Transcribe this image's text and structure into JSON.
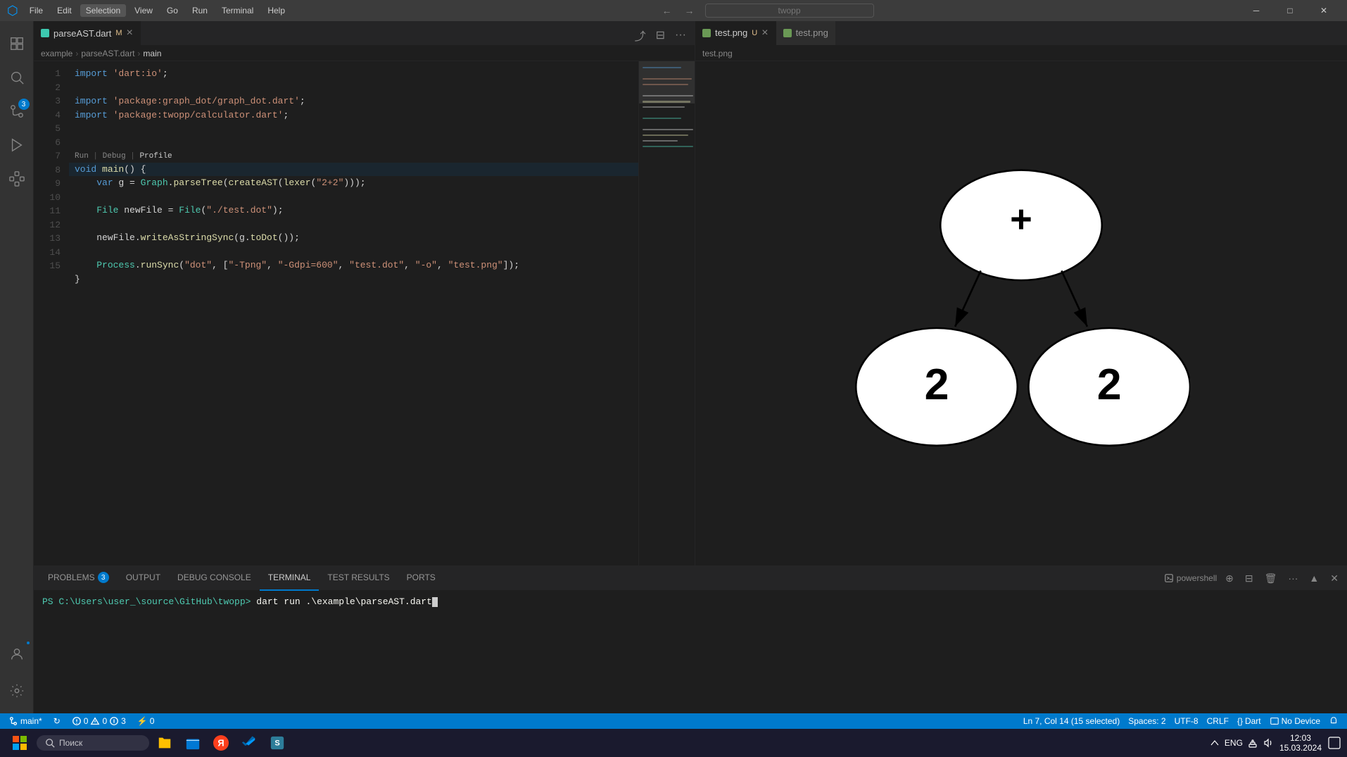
{
  "titlebar": {
    "icon": "⬡",
    "menu": [
      "File",
      "Edit",
      "Selection",
      "View",
      "Go",
      "Run",
      "Terminal",
      "Help"
    ],
    "search_placeholder": "twopp",
    "nav_back": "←",
    "nav_forward": "→",
    "controls": [
      "─",
      "□",
      "✕"
    ]
  },
  "left_editor": {
    "tab_filename": "parseAST.dart",
    "tab_status": "M",
    "breadcrumb": [
      "example",
      ">",
      "parseAST.dart",
      ">",
      "main"
    ],
    "lines": [
      {
        "num": 1,
        "tokens": [
          {
            "t": "kw",
            "v": "import"
          },
          {
            "t": "op",
            "v": " "
          },
          {
            "t": "str",
            "v": "'dart:io'"
          }
        ],
        "suffix": ";"
      },
      {
        "num": 2,
        "tokens": []
      },
      {
        "num": 3,
        "tokens": [
          {
            "t": "kw",
            "v": "import"
          },
          {
            "t": "op",
            "v": " "
          },
          {
            "t": "str",
            "v": "'package:graph_dot/graph_dot.dart'"
          }
        ],
        "suffix": ";"
      },
      {
        "num": 4,
        "tokens": [
          {
            "t": "kw",
            "v": "import"
          },
          {
            "t": "op",
            "v": " "
          },
          {
            "t": "str",
            "v": "'package:twopp/calculator.dart'"
          }
        ],
        "suffix": ";"
      },
      {
        "num": 5,
        "tokens": []
      },
      {
        "num": 6,
        "tokens": []
      },
      {
        "num": 7,
        "tokens": [
          {
            "t": "kw",
            "v": "void"
          },
          {
            "t": "op",
            "v": " "
          },
          {
            "t": "fn",
            "v": "main"
          },
          {
            "t": "op",
            "v": "() {"
          }
        ]
      },
      {
        "num": 8,
        "tokens": [
          {
            "t": "op",
            "v": "    "
          },
          {
            "t": "kw",
            "v": "var"
          },
          {
            "t": "op",
            "v": " g = "
          },
          {
            "t": "type",
            "v": "Graph"
          },
          {
            "t": "op",
            "v": "."
          },
          {
            "t": "fn",
            "v": "parseTree"
          },
          {
            "t": "op",
            "v": "("
          },
          {
            "t": "fn",
            "v": "createAST"
          },
          {
            "t": "op",
            "v": "("
          },
          {
            "t": "fn",
            "v": "lexer"
          },
          {
            "t": "op",
            "v": "("
          },
          {
            "t": "str",
            "v": "\"2+2\""
          },
          {
            "t": "op",
            "v": ")))"
          }
        ],
        "suffix": ";"
      },
      {
        "num": 9,
        "tokens": []
      },
      {
        "num": 10,
        "tokens": [
          {
            "t": "op",
            "v": "    "
          },
          {
            "t": "type",
            "v": "File"
          },
          {
            "t": "op",
            "v": " newFile = "
          },
          {
            "t": "type",
            "v": "File"
          },
          {
            "t": "op",
            "v": "("
          },
          {
            "t": "str",
            "v": "\"./test.dot\""
          },
          {
            "t": "op",
            "v": ")"
          }
        ],
        "suffix": ";"
      },
      {
        "num": 11,
        "tokens": []
      },
      {
        "num": 12,
        "tokens": [
          {
            "t": "op",
            "v": "    newFile."
          },
          {
            "t": "fn",
            "v": "writeAsStringSync"
          },
          {
            "t": "op",
            "v": "(g."
          },
          {
            "t": "fn",
            "v": "toDot"
          },
          {
            "t": "op",
            "v": "())"
          }
        ],
        "suffix": ";"
      },
      {
        "num": 13,
        "tokens": []
      },
      {
        "num": 14,
        "tokens": [
          {
            "t": "op",
            "v": "    "
          },
          {
            "t": "type",
            "v": "Process"
          },
          {
            "t": "op",
            "v": "."
          },
          {
            "t": "fn",
            "v": "runSync"
          },
          {
            "t": "op",
            "v": "("
          },
          {
            "t": "str",
            "v": "\"dot\""
          },
          {
            "t": "op",
            "v": ", ["
          },
          {
            "t": "str",
            "v": "\"-Tpng\""
          },
          {
            "t": "op",
            "v": ", "
          },
          {
            "t": "str",
            "v": "\"-Gdpi=600\""
          },
          {
            "t": "op",
            "v": ", "
          },
          {
            "t": "str",
            "v": "\"test.dot\""
          },
          {
            "t": "op",
            "v": ", "
          },
          {
            "t": "str",
            "v": "\"-o\""
          },
          {
            "t": "op",
            "v": ", "
          },
          {
            "t": "str",
            "v": "\"test.png\""
          },
          {
            "t": "op",
            "v": "])"
          }
        ],
        "suffix": ";"
      },
      {
        "num": 15,
        "tokens": [
          {
            "t": "op",
            "v": "}"
          }
        ]
      }
    ],
    "run_debug_profile": "Run | Debug | Profile"
  },
  "right_editor": {
    "tab_filename": "test.png",
    "tab_status": "U",
    "breadcrumb_item": "test.png"
  },
  "ast": {
    "root_label": "+",
    "left_label": "2",
    "right_label": "2"
  },
  "bottom_panel": {
    "tabs": [
      "PROBLEMS",
      "OUTPUT",
      "DEBUG CONSOLE",
      "TERMINAL",
      "TEST RESULTS",
      "PORTS"
    ],
    "problems_count": "3",
    "active_tab": "TERMINAL",
    "terminal_shell": "powershell",
    "terminal_prompt": "PS C:\\Users\\user_\\source\\GitHub\\twopp>",
    "terminal_command": "dart run .\\example\\parseAST.dart"
  },
  "status_bar": {
    "branch": "main*",
    "sync_icon": "↻",
    "errors": "0",
    "warnings": "0",
    "info": "3",
    "port_icon": "⚡",
    "ports": "0",
    "position": "Ln 7, Col 14 (15 selected)",
    "spaces": "Spaces: 2",
    "encoding": "UTF-8",
    "line_ending": "CRLF",
    "language": "Dart",
    "device": "No Device"
  },
  "taskbar": {
    "search_placeholder": "Поиск",
    "time": "12:03",
    "date": "15.03.2024",
    "lang": "ENG"
  }
}
